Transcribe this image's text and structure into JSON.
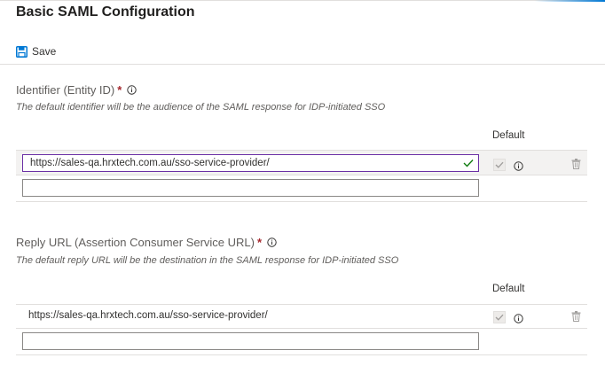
{
  "header": {
    "title": "Basic SAML Configuration"
  },
  "toolbar": {
    "save_label": "Save"
  },
  "identifier": {
    "label": "Identifier (Entity ID)",
    "required_mark": "*",
    "description": "The default identifier will be the audience of the SAML response for IDP-initiated SSO",
    "default_header": "Default",
    "rows": [
      {
        "value": "https://sales-qa.hrxtech.com.au/sso-service-provider/",
        "default_checked": true
      }
    ],
    "new_entry": {
      "value": "",
      "placeholder": ""
    }
  },
  "reply_url": {
    "label": "Reply URL (Assertion Consumer Service URL)",
    "required_mark": "*",
    "description": "The default reply URL will be the destination in the SAML response for IDP-initiated SSO",
    "default_header": "Default",
    "rows": [
      {
        "value": "https://sales-qa.hrxtech.com.au/sso-service-provider/",
        "default_checked": true
      }
    ],
    "new_entry": {
      "value": "",
      "placeholder": ""
    }
  },
  "icons": {
    "save": "save-icon",
    "info": "info-icon",
    "valid": "checkmark-icon",
    "delete": "trash-icon"
  },
  "colors": {
    "accent": "#0078d4",
    "valid": "#107c10",
    "required": "#a4262c",
    "focus_border": "#6b2fa5"
  }
}
